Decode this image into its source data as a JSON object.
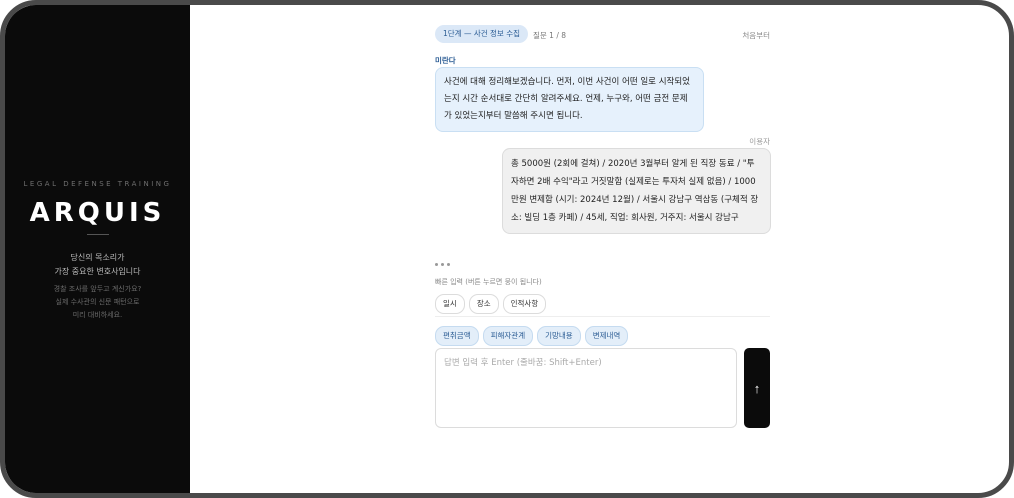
{
  "sidebar": {
    "tagline": "LEGAL DEFENSE TRAINING",
    "logo": "ARQUIS",
    "lead_line1": "당신의 목소리가",
    "lead_line2": "가장 중요한 변호사입니다",
    "sub_line1": "경찰 조사를 앞두고 계신가요?",
    "sub_line2": "실제 수사관의 신문 패턴으로",
    "sub_line3": "미리 대비하세요."
  },
  "header": {
    "step_label": "1단계 — 사건 정보 수집",
    "question_count": "질문 1 / 8",
    "restart_label": "처음부터"
  },
  "chat": {
    "bot_name": "미란다",
    "bot_message": "사건에 대해 정리해보겠습니다. 먼저, 이번 사건이 어떤 일로 시작되었는지 시간 순서대로 간단히 알려주세요. 언제, 누구와, 어떤 금전 문제가 있었는지부터 말씀해 주시면 됩니다.",
    "user_name": "이용자",
    "user_message": "총 5000원 (2회에 걸쳐) / 2020년 3월부터 알게 된 직장 동료 / \"투자하면 2배 수익\"라고 거짓말함 (실제로는 투자처 실제 없음) / 1000만원 변제함 (시기: 2024년 12월) / 서울시 강남구 역삼동 (구체적 장소: 빌딩 1층 카페) / 45세, 직업: 회사원, 거주지: 서울시 강남구"
  },
  "quick": {
    "label": "빠른 입력 (버튼 누르면 뭉이 됩니다)",
    "chips_row1": [
      "일시",
      "장소",
      "인적사항"
    ],
    "chips_row2": [
      "편취금액",
      "피해자관계",
      "기망내용",
      "변제내역"
    ]
  },
  "input": {
    "placeholder": "답변 입력 후 Enter (줄바꿈: Shift+Enter)",
    "send_icon": "↑"
  }
}
